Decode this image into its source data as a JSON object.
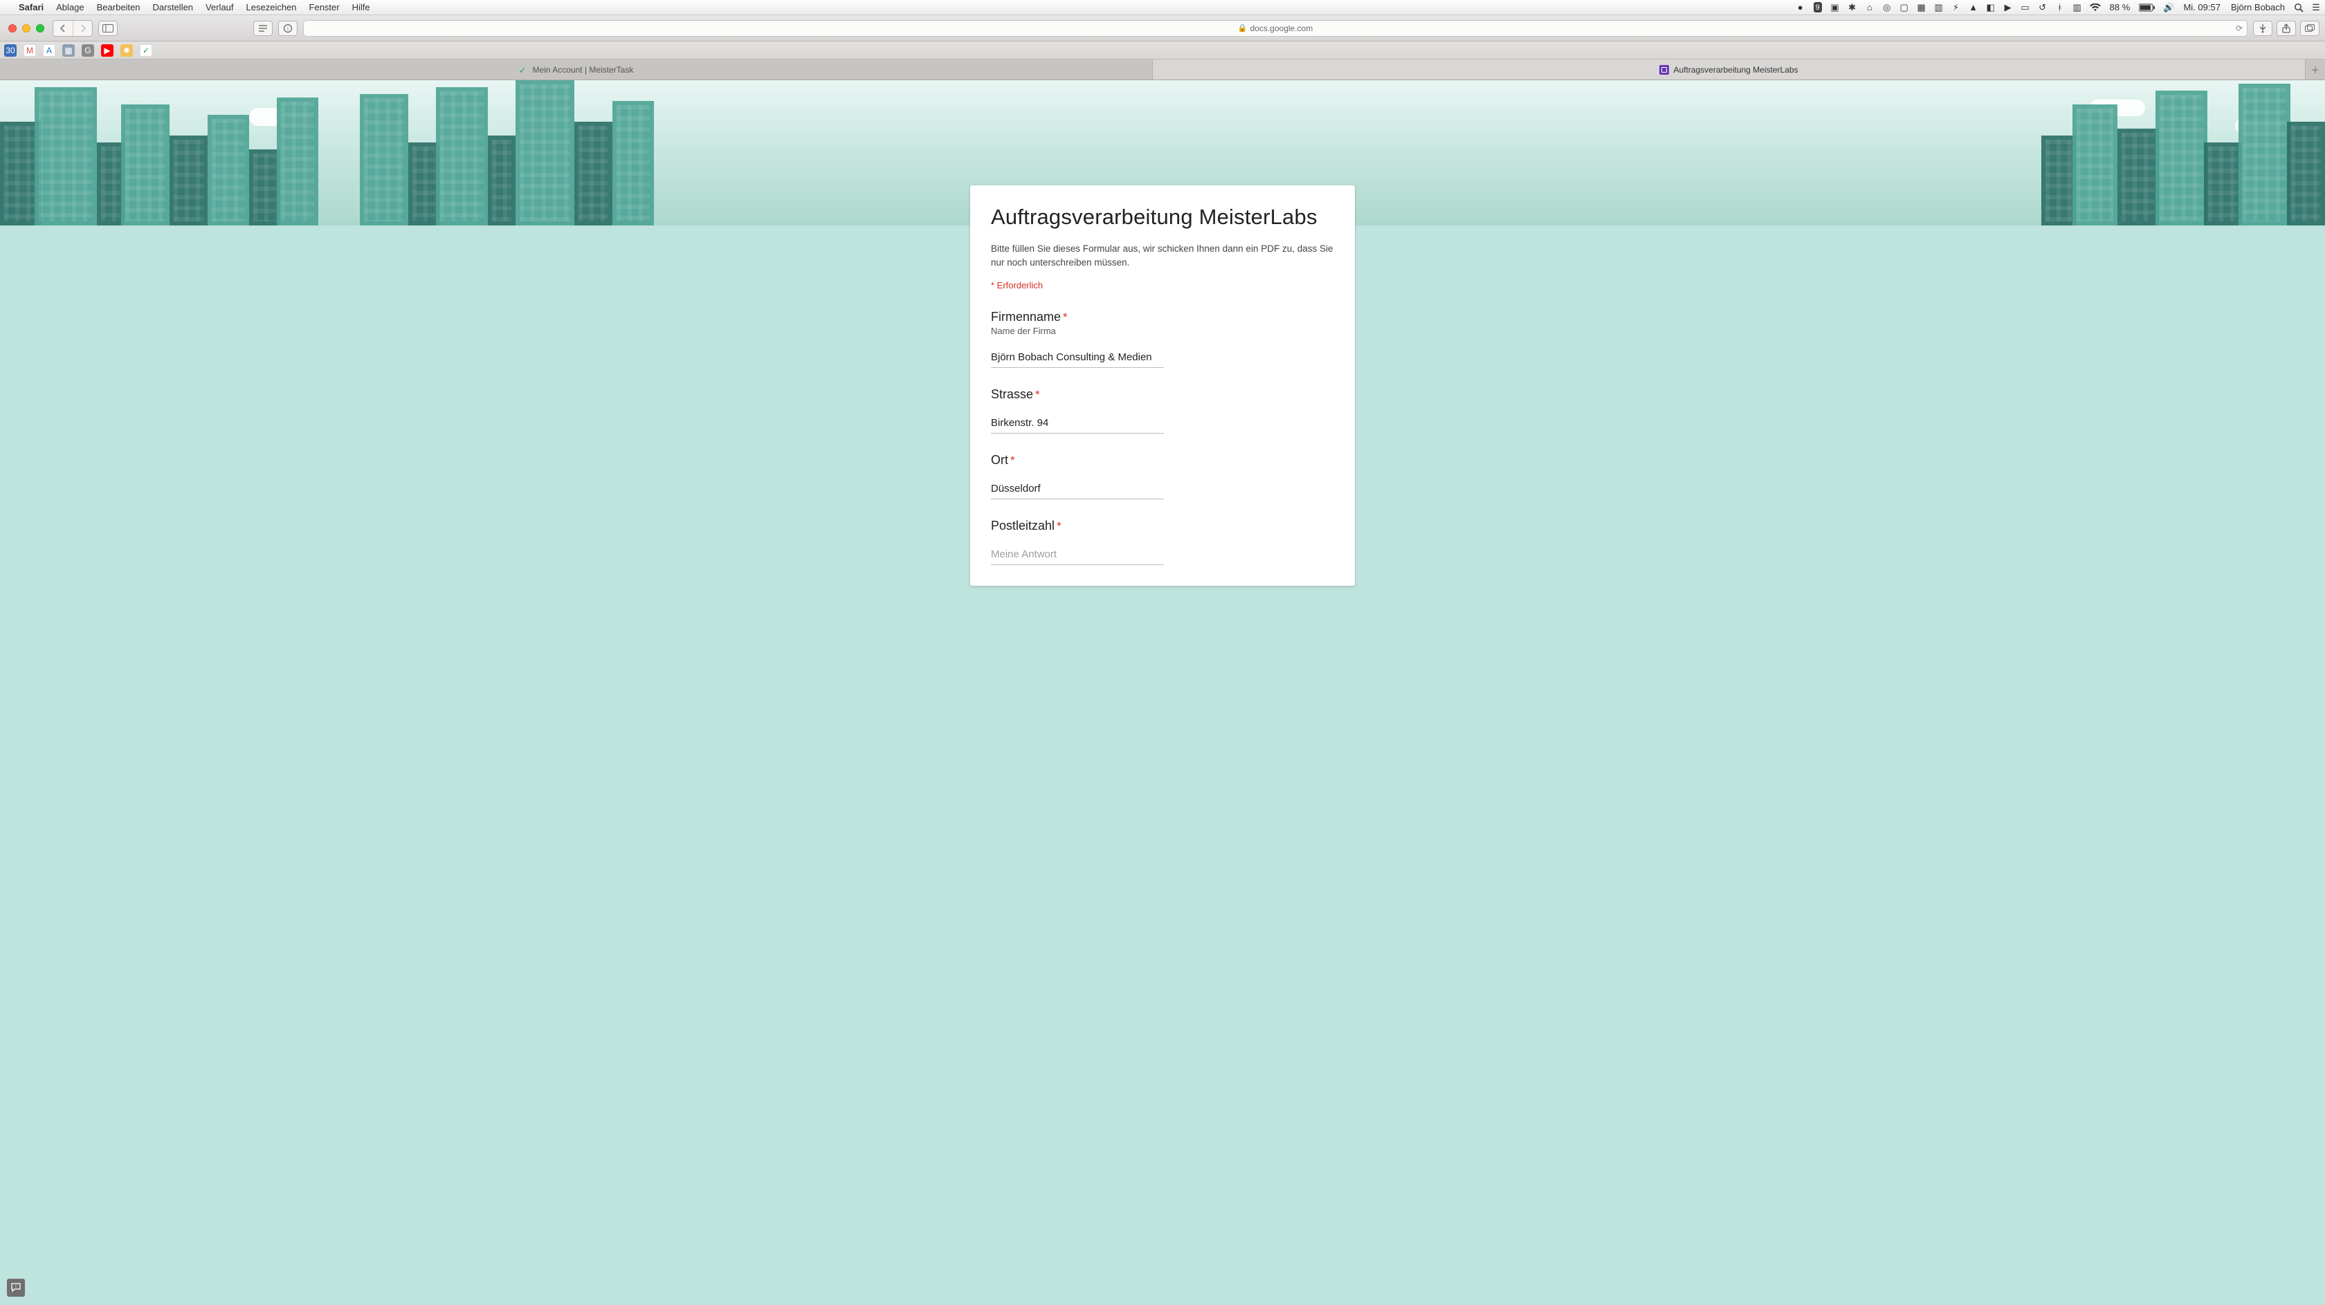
{
  "menubar": {
    "app": "Safari",
    "items": [
      "Ablage",
      "Bearbeiten",
      "Darstellen",
      "Verlauf",
      "Lesezeichen",
      "Fenster",
      "Hilfe"
    ],
    "status_badge": "9",
    "battery_pct": "88 %",
    "clock": "Mi. 09:57",
    "user": "Björn Bobach"
  },
  "toolbar": {
    "url_host": "docs.google.com"
  },
  "tabs": {
    "left_label": "Mein Account | MeisterTask",
    "right_label": "Auftragsverarbeitung MeisterLabs"
  },
  "form": {
    "title": "Auftragsverarbeitung MeisterLabs",
    "description": "Bitte füllen Sie dieses Formular aus, wir schicken Ihnen dann ein PDF zu, dass Sie nur noch unterschreiben müssen.",
    "required_hint": "* Erforderlich",
    "answer_placeholder": "Meine Antwort",
    "q_firmenname": {
      "label": "Firmenname",
      "help": "Name der Firma",
      "value": "Björn Bobach Consulting & Medien"
    },
    "q_strasse": {
      "label": "Strasse",
      "value": "Birkenstr. 94"
    },
    "q_ort": {
      "label": "Ort",
      "value": "Düsseldorf"
    },
    "q_plz": {
      "label": "Postleitzahl",
      "value": ""
    }
  }
}
